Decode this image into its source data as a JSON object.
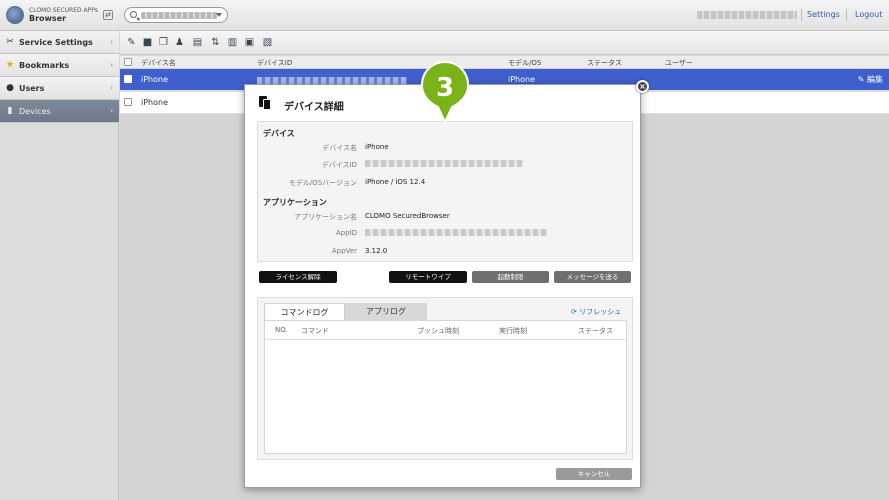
{
  "header": {
    "app_name_line1": "CLOMO SECURED APPs",
    "app_name_line2": "Browser",
    "settings_link": "Settings",
    "logout_link": "Logout"
  },
  "sidebar": {
    "items": [
      {
        "label": "Service Settings",
        "icon": "tools-icon"
      },
      {
        "label": "Bookmarks",
        "icon": "star-icon"
      },
      {
        "label": "Users",
        "icon": "user-icon"
      },
      {
        "label": "Devices",
        "icon": "device-icon",
        "active": true
      }
    ]
  },
  "table": {
    "columns": [
      "デバイス名",
      "デバイスID",
      "モデル/OS",
      "ステータス",
      "ユーザー"
    ],
    "rows": [
      {
        "name": "iPhone",
        "os": "iPhone",
        "selected": true,
        "edit_label": "編集"
      },
      {
        "name": "iPhone",
        "os": "",
        "selected": false
      }
    ]
  },
  "modal": {
    "title": "デバイス詳細",
    "device_section": "デバイス",
    "device_name_label": "デバイス名",
    "device_name_value": "iPhone",
    "device_id_label": "デバイスID",
    "model_os_label": "モデル/OSバージョン",
    "model_os_value": "iPhone / iOS 12.4",
    "app_section": "アプリケーション",
    "app_name_label": "アプリケーション名",
    "app_name_value": "CLOMO SecuredBrowser",
    "app_id_label": "AppID",
    "app_ver_label": "AppVer",
    "app_ver_value": "3.12.0",
    "buttons": {
      "license_release": "ライセンス解除",
      "remote_wipe": "リモートワイプ",
      "launch_restriction": "起動制限",
      "send_message": "メッセージを送る",
      "cancel": "キャンセル"
    },
    "tabs": {
      "command_log": "コマンドログ",
      "app_log": "アプリログ"
    },
    "refresh": "リフレッシュ",
    "log_columns": {
      "no": "NO.",
      "command": "コマンド",
      "push_time": "プッシュ時刻",
      "exec_time": "実行時刻",
      "status": "ステータス"
    }
  },
  "callout": {
    "number": "3",
    "color": "#7ab317"
  },
  "colors": {
    "selected_row": "#3f5fcc",
    "link": "#2a5db0"
  }
}
